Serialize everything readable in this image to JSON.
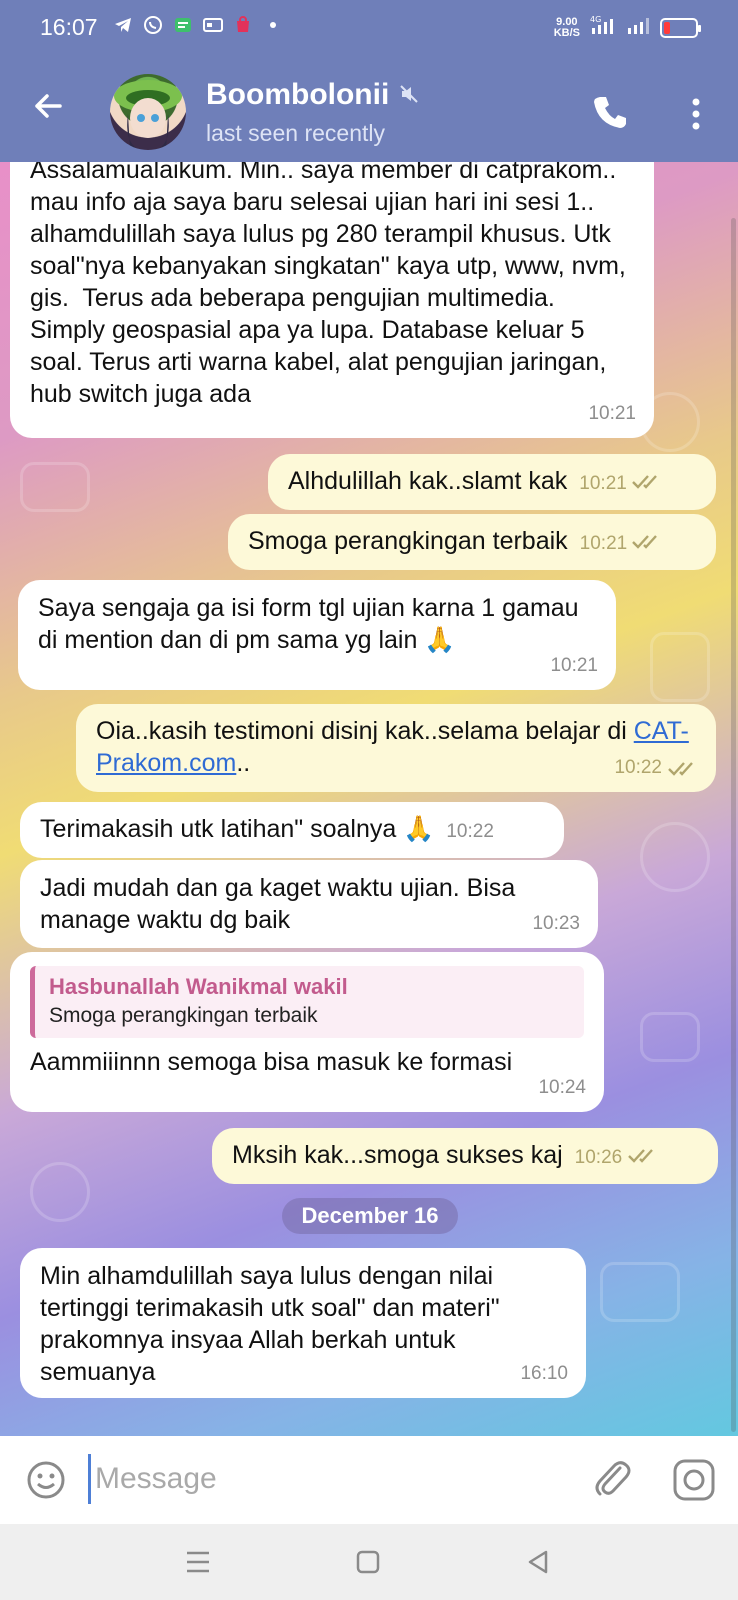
{
  "status_bar": {
    "time": "16:07",
    "speed_top": "9.00",
    "speed_bottom": "KB/S",
    "network": "4G",
    "battery_level": 0.2,
    "battery_color": "#ff3b3b"
  },
  "header": {
    "name": "Boombolonii",
    "status": "last seen recently",
    "muted": true,
    "accent": "#6f7fb9"
  },
  "messages": [
    {
      "dir": "in",
      "text": "Assalamualaikum. Min.. saya member di catprakom.. mau info aja saya baru selesai ujian hari ini sesi 1.. alhamdulillah saya lulus pg 280 terampil khusus. Utk soal\"nya kebanyakan singkatan\" kaya utp, www, nvm, gis.  Terus ada beberapa pengujian multimedia. Simply geospasial apa ya lupa. Database keluar 5 soal. Terus arti warna kabel, alat pengujian jaringan, hub switch juga ada",
      "time": "10:21"
    },
    {
      "dir": "out",
      "text": "Alhdulillah kak..slamt kak",
      "time": "10:21"
    },
    {
      "dir": "out",
      "text": "Smoga perangkingan terbaik",
      "time": "10:21"
    },
    {
      "dir": "in",
      "text": "Saya sengaja ga isi form tgl ujian karna 1 gamau di mention dan di pm sama yg lain 🙏",
      "time": "10:21"
    },
    {
      "dir": "out",
      "text": "Oia..kasih testimoni disinj kak..selama belajar di ",
      "link": "CAT-Prakom.com",
      "suffix": "..",
      "time": "10:22"
    },
    {
      "dir": "in",
      "text": "Terimakasih utk latihan\" soalnya 🙏",
      "time": "10:22"
    },
    {
      "dir": "in",
      "text": "Jadi mudah dan ga kaget waktu ujian. Bisa manage waktu dg baik",
      "time": "10:23"
    },
    {
      "dir": "in",
      "reply_name": "Hasbunallah Wanikmal wakil",
      "reply_text": "Smoga perangkingan terbaik",
      "text": "Aammiiinnn semoga bisa masuk ke formasi",
      "time": "10:24"
    },
    {
      "dir": "out",
      "text": "Mksih kak...smoga sukses kaj",
      "time": "10:26"
    },
    {
      "dir": "in",
      "text": "Min alhamdulillah saya lulus dengan nilai tertinggi terimakasih utk soal\" dan materi\" prakomnya insyaa Allah berkah untuk semuanya",
      "time": "16:10"
    }
  ],
  "date_separator": "December 16",
  "input": {
    "placeholder": "Message",
    "value": ""
  },
  "icons": {
    "back": "arrow-left-icon",
    "call": "phone-icon",
    "menu": "more-vertical-icon",
    "emoji": "smiley-icon",
    "attach": "paperclip-icon",
    "camera": "camera-icon"
  }
}
